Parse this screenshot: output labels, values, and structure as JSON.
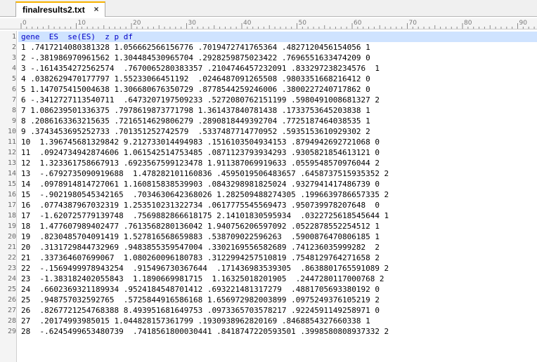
{
  "tab": {
    "title": "finalresults2.txt",
    "close_glyph": "×"
  },
  "ruler": {
    "labels": [
      "0",
      "10",
      "20",
      "30",
      "40",
      "50",
      "60",
      "70",
      "80",
      "90"
    ]
  },
  "lines": [
    "gene  ES  se(ES)  z p df",
    "1 .7417214080381328 1.056662566156776 .7019472741765364 .4827120456154056 1",
    "2 -.381986970961562 1.304484530965704 .2928259875023422 .7696551633474209 0",
    "3 -.1614354272562574  .7670065280383357 .2104746457232091 .833297238234576  1",
    "4 .0382629470177797 1.55233066451192  .0246487091265508 .9803351668216412 0",
    "5 1.147075415004638 1.306680676350729 .8778544259246006 .3800227240717862 0",
    "6 -.3412727113540711  .6473207197509233 .5272080762151199 .5980491008681327 2",
    "7 1.086239501336375 .7978619873771798 1.361437840781438 .1733753645203838 1",
    "8 .2086163363215635 .7216514629806279 .2890818449392704 .7725187464038535 1",
    "9 .3743453695252733 .701351252742579  .5337487714770952 .5935153610929302 2",
    "10  1.396745681329842 9.212733014494983 .1516103504934153 .8794942692721068 0",
    "11  .0924734942874606 1.061542514753485 .0871123793934293 .9305821854613121 0",
    "12  1.323361758667913 .6923567599123478 1.911387069919633 .0559548570976044 2",
    "13  -.6792735090919688  1.478282101160836 .4595019506483657 .6458737515935352 2",
    "14  .0978914814727061 1.160815838539903 .0843298981825024 .9327941417486739 0",
    "15  -.9021980545342165  .7034630642368026 1.282509488274305 .1996639786657335 2",
    "16  .0774387967032319 1.253510231322734 .0617775545569473 .950739978207648  0",
    "17  -1.620725779139748  .7569882866618175 2.14101830595934  .0322725618545644 1",
    "18  1.477607989402477 .7613568280136042 1.940756206597092 .0522878552254512 1",
    "19  .8230485704091419 1.527816568659883 .538709022596263  .5900876470806185 1",
    "20  .3131729844732969 .9483855359547004 .3302169556582689 .741236035999282  2",
    "21  .337364607699067  1.080260096180783 .3122994257510819 .7548129764271658 2",
    "22  -.1569499978943254  .915496730367644  .171436983539305  .8638801765591089 2",
    "23  -1.383182402055843  1.1890669981715  1.16325018201905  .2447280117000768 2",
    "24  .6602369321189934 .9524184548701412 .693221481317279  .4881705693380192 0",
    "25  .948757032592765  .5725844916586168 1.656972982003899 .0975249376105219 2",
    "26  .8267721254768388 8.493951681649753 .0973365703578217 .9224591149258971 0",
    "27  .20174993985015 1.044828157361799 .1930938962820169 .8468854327660338 1",
    "28  -.6245499653480739  .7418561800030441 .8418747220593501 .3998580808937332 2"
  ]
}
